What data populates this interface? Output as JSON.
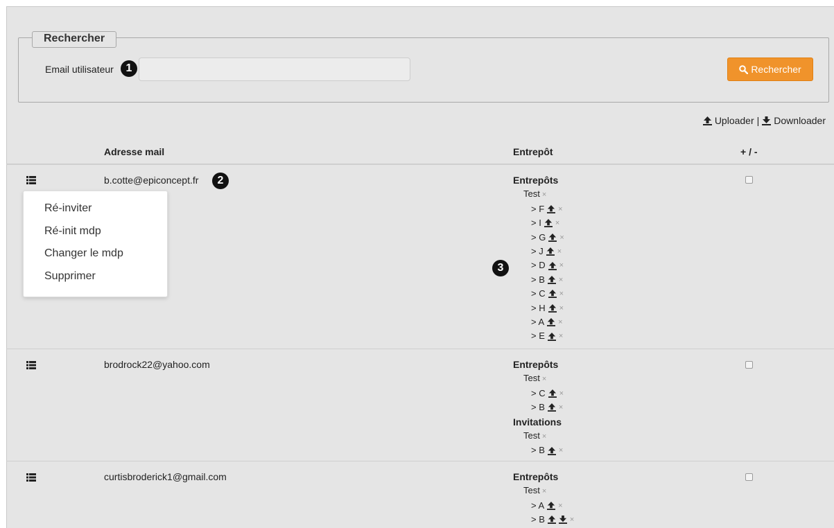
{
  "search": {
    "legend": "Rechercher",
    "email_label": "Email utilisateur",
    "email_value": "",
    "button_label": "Rechercher"
  },
  "callouts": [
    "1",
    "2",
    "3"
  ],
  "legend": {
    "uploader": "Uploader",
    "separator": "|",
    "downloader": "Downloader"
  },
  "table": {
    "headers": {
      "email": "Adresse mail",
      "warehouse": "Entrepôt",
      "plusminus": "+ / -"
    },
    "rows": [
      {
        "email": "b.cotte@epiconcept.fr",
        "sections": [
          {
            "title": "Entrepôts",
            "groups": [
              {
                "name": "Test",
                "items": [
                  {
                    "label": "> F",
                    "icons": [
                      "upload-icon"
                    ]
                  },
                  {
                    "label": "> I",
                    "icons": [
                      "upload-icon"
                    ]
                  },
                  {
                    "label": "> G",
                    "icons": [
                      "upload-icon"
                    ]
                  },
                  {
                    "label": "> J",
                    "icons": [
                      "upload-icon"
                    ]
                  },
                  {
                    "label": "> D",
                    "icons": [
                      "upload-icon"
                    ]
                  },
                  {
                    "label": "> B",
                    "icons": [
                      "upload-icon"
                    ]
                  },
                  {
                    "label": "> C",
                    "icons": [
                      "upload-icon"
                    ]
                  },
                  {
                    "label": "> H",
                    "icons": [
                      "upload-icon"
                    ]
                  },
                  {
                    "label": "> A",
                    "icons": [
                      "upload-icon"
                    ]
                  },
                  {
                    "label": "> E",
                    "icons": [
                      "upload-icon"
                    ]
                  }
                ]
              }
            ]
          }
        ]
      },
      {
        "email": "brodrock22@yahoo.com",
        "sections": [
          {
            "title": "Entrepôts",
            "groups": [
              {
                "name": "Test",
                "items": [
                  {
                    "label": "> C",
                    "icons": [
                      "upload-icon"
                    ]
                  },
                  {
                    "label": "> B",
                    "icons": [
                      "upload-icon"
                    ]
                  }
                ]
              }
            ]
          },
          {
            "title": "Invitations",
            "groups": [
              {
                "name": "Test",
                "items": [
                  {
                    "label": "> B",
                    "icons": [
                      "upload-icon"
                    ]
                  }
                ]
              }
            ]
          }
        ]
      },
      {
        "email": "curtisbroderick1@gmail.com",
        "sections": [
          {
            "title": "Entrepôts",
            "groups": [
              {
                "name": "Test",
                "items": [
                  {
                    "label": "> A",
                    "icons": [
                      "upload-icon"
                    ]
                  },
                  {
                    "label": "> B",
                    "icons": [
                      "upload-icon",
                      "download-icon"
                    ]
                  }
                ]
              }
            ]
          }
        ]
      }
    ]
  },
  "dropdown": {
    "items": [
      "Ré-inviter",
      "Ré-init mdp",
      "Changer le mdp",
      "Supprimer"
    ]
  },
  "remove_glyph": "×",
  "colors": {
    "primary_button": "#f0932b",
    "page_background": "#e5e5e5"
  }
}
